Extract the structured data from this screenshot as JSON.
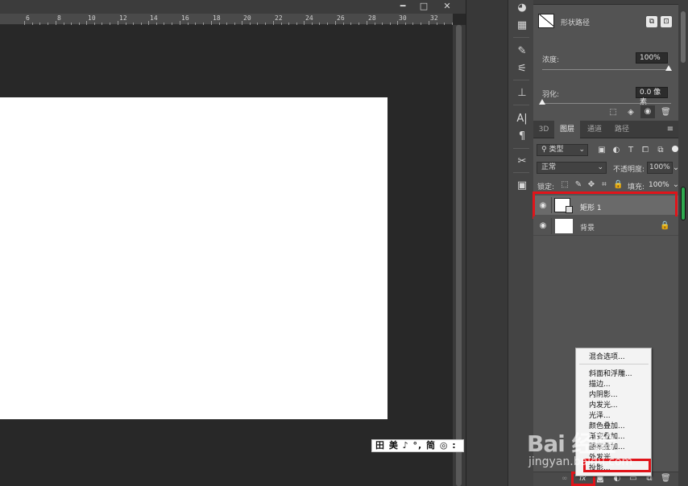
{
  "window": {
    "minimize": "━",
    "maximize": "□",
    "close": "✕"
  },
  "ruler": {
    "ticks": [
      "6",
      "8",
      "10",
      "12",
      "14",
      "16",
      "18",
      "20",
      "22",
      "24",
      "26",
      "28",
      "30",
      "32"
    ]
  },
  "ime_bar": {
    "text": "田 美 ♪ °, 简 ◎ :"
  },
  "properties": {
    "shape_label": "形状路径",
    "density_label": "浓度:",
    "density_value": "100%",
    "feather_label": "羽化:",
    "feather_value": "0.0 像素"
  },
  "layers_panel": {
    "tabs": [
      "3D",
      "图层",
      "通道",
      "路径"
    ],
    "active_tab": "图层",
    "filter_label": "类型",
    "blend_mode": "正常",
    "opacity_label": "不透明度:",
    "opacity_value": "100%",
    "lock_label": "锁定:",
    "fill_label": "填充:",
    "fill_value": "100%",
    "layers": [
      {
        "name": "矩形 1",
        "selected": true,
        "locked": false
      },
      {
        "name": "背景",
        "selected": false,
        "locked": true
      }
    ],
    "fx_label": "fx",
    "link_label": "∞"
  },
  "fx_menu": {
    "items": [
      "混合选项...",
      "斜面和浮雕...",
      "描边...",
      "内阴影...",
      "内发光...",
      "光泽...",
      "颜色叠加...",
      "渐变叠加...",
      "图案叠加...",
      "外发光...",
      "投影..."
    ]
  },
  "watermark": {
    "brand": "Bai 经验",
    "url": "jingyan.baidu.com"
  },
  "colors": {
    "highlight": "#e0141a",
    "canvas": "#ffffff",
    "panel": "#535353"
  }
}
